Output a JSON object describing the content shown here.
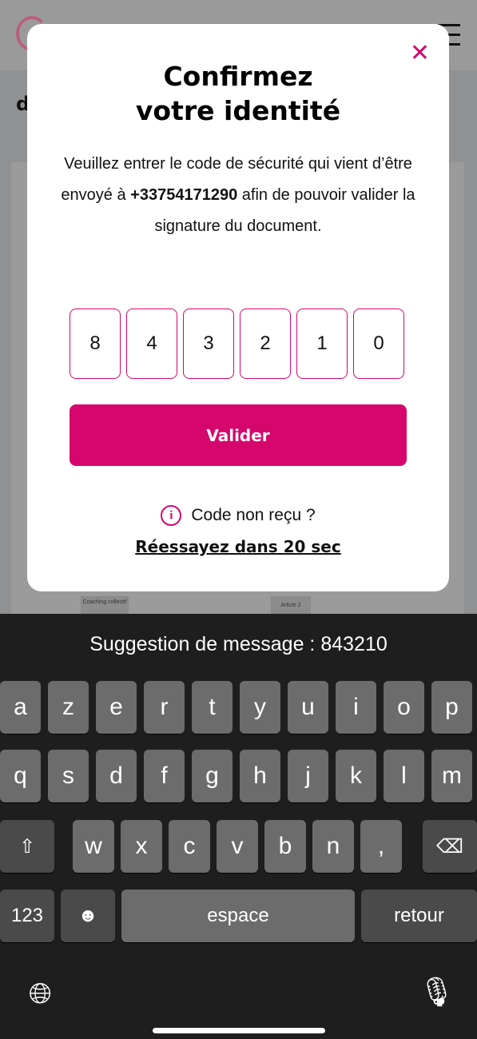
{
  "background": {
    "page_initial": "d",
    "diagram_boxes": [
      "Coaching collectif",
      "Article 2"
    ]
  },
  "modal": {
    "close_icon": "close-icon",
    "title_line1": "Confirmez",
    "title_line2": "votre identité",
    "desc_part1": "Veuillez entrer le code de sécurité qui vient d’être envoyé à ",
    "phone": "+33754171290",
    "desc_part2": " afin de pouvoir valider la signature du document.",
    "code": [
      "8",
      "4",
      "3",
      "2",
      "1",
      "0"
    ],
    "validate_label": "Valider",
    "not_received": "Code non reçu ?",
    "retry": "Réessayez dans 20 sec",
    "accent": "#d5076c"
  },
  "keyboard": {
    "suggestion": "Suggestion de message : 843210",
    "row1": [
      "a",
      "z",
      "e",
      "r",
      "t",
      "y",
      "u",
      "i",
      "o",
      "p"
    ],
    "row2": [
      "q",
      "s",
      "d",
      "f",
      "g",
      "h",
      "j",
      "k",
      "l",
      "m"
    ],
    "row3": [
      "w",
      "x",
      "c",
      "v",
      "b",
      "n",
      ","
    ],
    "numbers": "123",
    "space": "espace",
    "return": "retour"
  }
}
